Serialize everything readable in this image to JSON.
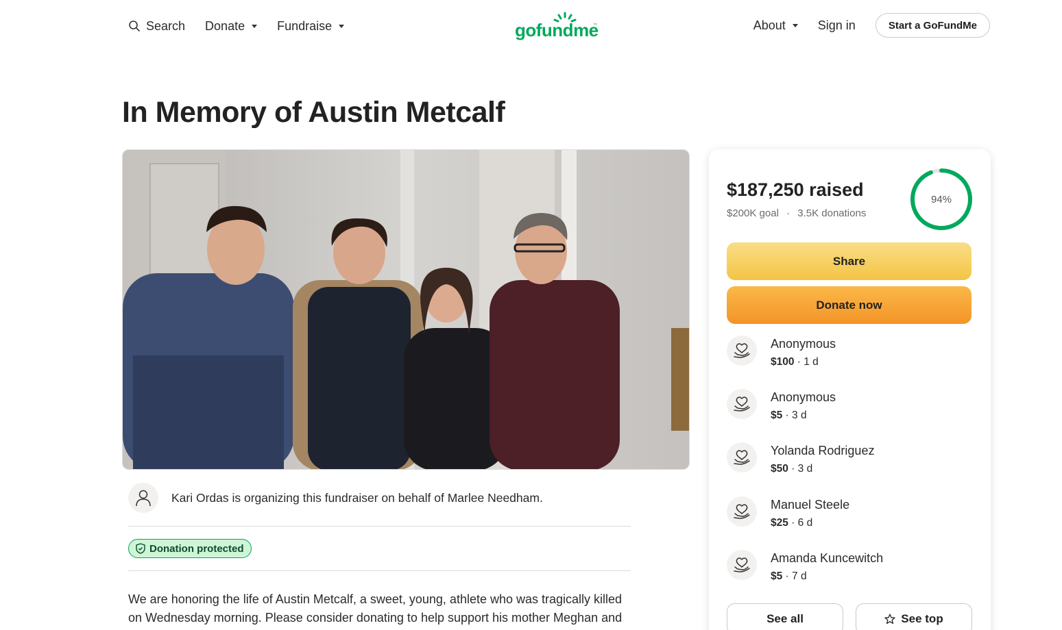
{
  "header": {
    "search_label": "Search",
    "donate_label": "Donate",
    "fundraise_label": "Fundraise",
    "logo_text": "gofundme",
    "logo_tm": "™",
    "about_label": "About",
    "signin_label": "Sign in",
    "start_label": "Start a GoFundMe"
  },
  "page": {
    "title": "In Memory of Austin Metcalf",
    "organizer_text": "Kari Ordas is organizing this fundraiser on behalf of Marlee Needham.",
    "protected_label": "Donation protected",
    "story": "We are honoring the life of Austin Metcalf, a sweet, young, athlete who was tragically killed on Wednesday morning. Please consider donating to help support his mother Meghan and"
  },
  "summary": {
    "raised": "$187,250 raised",
    "goal": "$200K goal",
    "separator": "·",
    "donations": "3.5K donations",
    "percent_label": "94%",
    "percent_value": 0.94,
    "share_label": "Share",
    "donate_label": "Donate now",
    "see_all_label": "See all",
    "see_top_label": "See top"
  },
  "donations": [
    {
      "name": "Anonymous",
      "amount": "$100",
      "time": " · 1 d"
    },
    {
      "name": "Anonymous",
      "amount": "$5",
      "time": " · 3 d"
    },
    {
      "name": "Yolanda Rodriguez",
      "amount": "$50",
      "time": " · 3 d"
    },
    {
      "name": "Manuel Steele",
      "amount": "$25",
      "time": " · 6 d"
    },
    {
      "name": "Amanda Kuncewitch",
      "amount": "$5",
      "time": " · 7 d"
    }
  ],
  "colors": {
    "brand_green": "#02a95c",
    "share_yellow": "#f4c444",
    "donate_orange": "#f39428"
  }
}
